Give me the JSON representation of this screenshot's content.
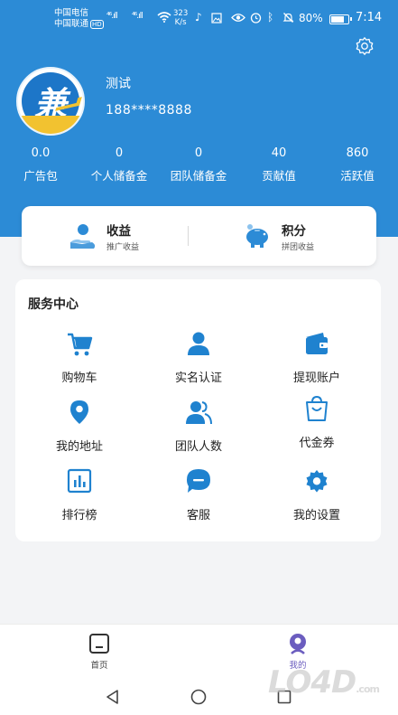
{
  "status_bar": {
    "carrier_1": "中国电信",
    "carrier_2": "中国联通",
    "hd_badge": "HD",
    "sig1": "⁴⁶.ıll",
    "sig2": "⁴⁶.ıll",
    "net_speed_value": "323",
    "net_speed_unit": "K/s",
    "battery_percent": "80%",
    "battery_level": 0.8,
    "time": "7:14"
  },
  "profile": {
    "avatar_icon": "brand-logo-icon",
    "avatar_char": "兼",
    "name": "测试",
    "phone": "188****8888"
  },
  "stats": [
    {
      "value": "0.0",
      "label": "广告包"
    },
    {
      "value": "0",
      "label": "个人储备金"
    },
    {
      "value": "0",
      "label": "团队储备金"
    },
    {
      "value": "40",
      "label": "贡献值"
    },
    {
      "value": "860",
      "label": "活跃值"
    }
  ],
  "earnings": {
    "income": {
      "title": "收益",
      "subtitle": "推广收益",
      "icon": "hand-coin-icon"
    },
    "points": {
      "title": "积分",
      "subtitle": "拼团收益",
      "icon": "piggy-bank-icon"
    }
  },
  "service_center": {
    "title": "服务中心",
    "items": [
      {
        "label": "购物车",
        "icon": "cart-icon"
      },
      {
        "label": "实名认证",
        "icon": "user-icon"
      },
      {
        "label": "提现账户",
        "icon": "wallet-icon"
      },
      {
        "label": "我的地址",
        "icon": "location-pin-icon"
      },
      {
        "label": "团队人数",
        "icon": "team-icon"
      },
      {
        "label": "代金券",
        "icon": "shopping-bag-icon"
      },
      {
        "label": "排行榜",
        "icon": "bar-chart-icon"
      },
      {
        "label": "客服",
        "icon": "chat-bubble-icon"
      },
      {
        "label": "我的设置",
        "icon": "gear-icon"
      }
    ]
  },
  "bottom_nav": {
    "home": {
      "label": "首页",
      "icon": "home-icon"
    },
    "mine": {
      "label": "我的",
      "icon": "profile-icon"
    }
  },
  "watermark": {
    "text": "LO4D",
    "suffix": ".com"
  },
  "colors": {
    "primary": "#2c8bd6",
    "icon_blue": "#1f82cf",
    "background": "#f3f4f6",
    "active_tab": "#6b5dbf"
  }
}
